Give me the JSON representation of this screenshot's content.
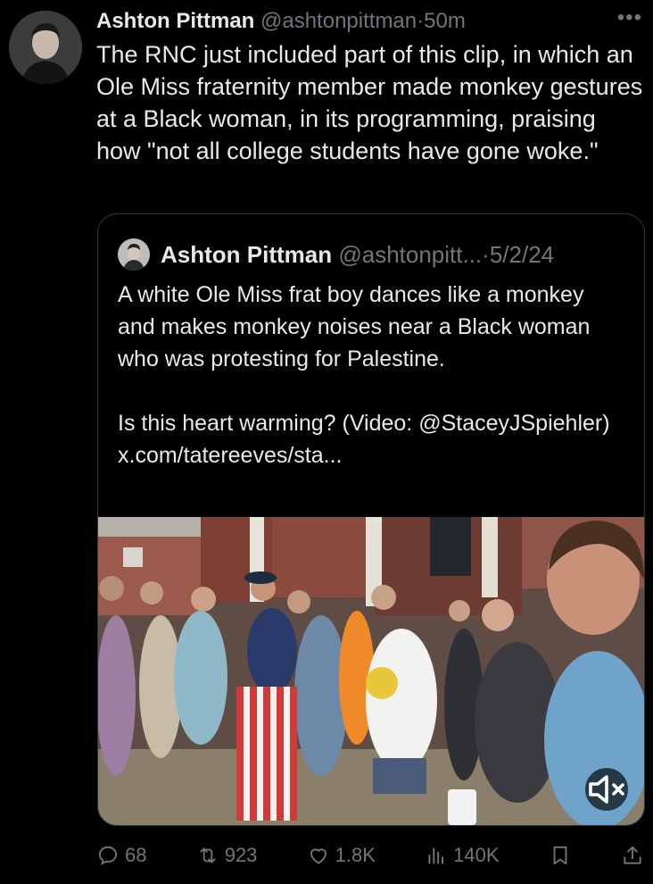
{
  "tweet": {
    "author_name": "Ashton Pittman",
    "author_handle": "@ashtonpittman",
    "separator": "·",
    "time": "50m",
    "text": "The RNC just included part of this clip, in which an Ole Miss fraternity member made monkey gestures at a Black woman, in its programming, praising how \"not all college students have gone woke.\""
  },
  "quote": {
    "author_name": "Ashton Pittman",
    "author_handle": "@ashtonpitt...",
    "separator": "·",
    "date": "5/2/24",
    "text_p1": "A white Ole Miss frat boy dances like a monkey and makes monkey noises near a Black woman who was protesting for Palestine.",
    "text_p2": "Is this heart warming? (Video: @StaceyJSpiehler) x.com/tatereeves/sta..."
  },
  "actions": {
    "replies": "68",
    "reposts": "923",
    "likes": "1.8K",
    "views": "140K"
  },
  "icons": {
    "more": "more-icon",
    "reply": "reply-icon",
    "repost": "repost-icon",
    "like": "heart-icon",
    "views": "views-icon",
    "bookmark": "bookmark-icon",
    "share": "share-icon",
    "mute": "mute-icon"
  }
}
